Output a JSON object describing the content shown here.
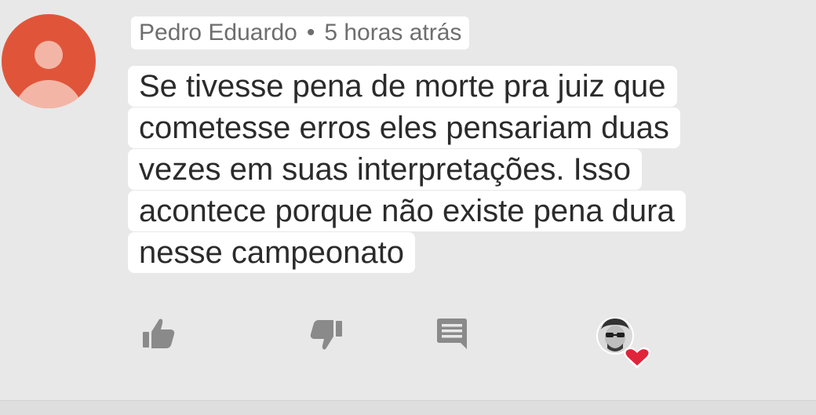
{
  "comment": {
    "author": "Pedro Eduardo",
    "separator": "•",
    "timestamp": "5 horas atrás",
    "text_lines": [
      "Se tivesse pena de morte pra juiz que",
      "cometesse erros eles pensariam duas",
      "vezes em suas interpretações. Isso",
      "acontece porque não existe pena dura",
      "nesse campeonato"
    ]
  },
  "actions": {
    "like_icon": "thumb-up-icon",
    "dislike_icon": "thumb-down-icon",
    "reply_icon": "comment-icon",
    "reaction_icon": "creator-heart-icon"
  },
  "colors": {
    "avatar_bg": "#e0553a",
    "avatar_figure": "#f3b6a6",
    "icon_gray": "#8a8a8a",
    "heart_red": "#e0243a",
    "text": "#2b2b2b",
    "meta_text": "#6e6e6e"
  }
}
